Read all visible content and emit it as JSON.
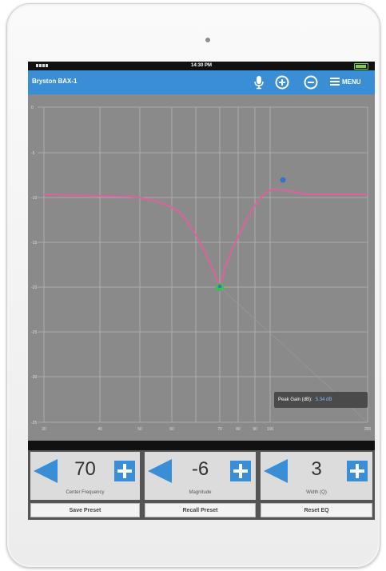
{
  "status": {
    "time": "14:30 PM"
  },
  "app": {
    "title": "Bryston BAX-1",
    "menu_label": "MENU"
  },
  "graph": {
    "y_ticks": [
      "0",
      "-5",
      "-10",
      "-15",
      "-20",
      "-25",
      "-30",
      "-35"
    ],
    "x_ticks": [
      "20",
      "40",
      "50",
      "60",
      "70",
      "80",
      "90",
      "100",
      "200"
    ],
    "peak_label": "Peak Gain (dB):",
    "peak_value": "5.34 dB"
  },
  "controls": [
    {
      "value": "70",
      "label": "Center Frequency"
    },
    {
      "value": "-6",
      "label": "Magnitude"
    },
    {
      "value": "3",
      "label": "Width (Q)"
    }
  ],
  "presets": {
    "save": "Save Preset",
    "recall": "Recall Preset",
    "reset": "Reset EQ"
  },
  "colors": {
    "accent": "#3a8ed5",
    "curve": "#e0609e",
    "marker_green": "#3cc24a",
    "marker_blue": "#3a6fd0"
  },
  "icons": {
    "mic": "microphone-icon",
    "zoom_in": "plus-circle-icon",
    "zoom_out": "minus-circle-icon",
    "menu": "hamburger-icon"
  }
}
